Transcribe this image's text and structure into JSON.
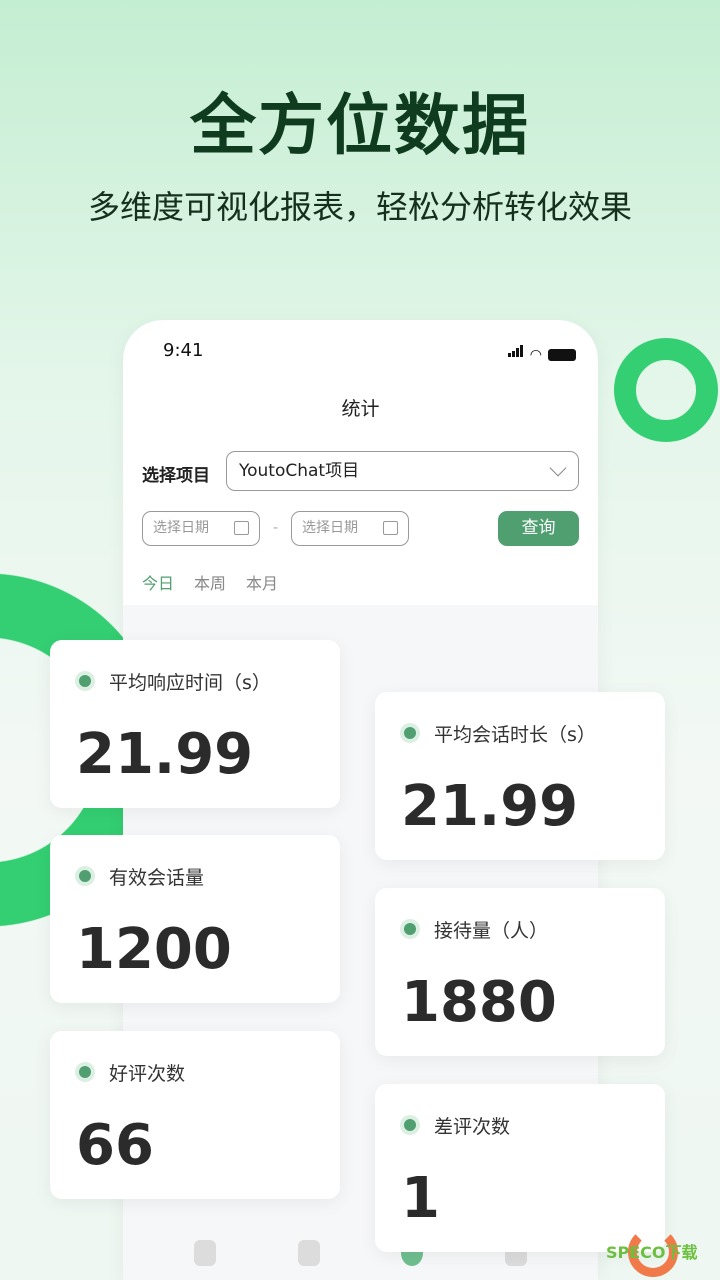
{
  "headline": "全方位数据",
  "subheadline": "多维度可视化报表，轻松分析转化效果",
  "phone": {
    "time": "9:41",
    "nav_title": "统计",
    "project_label": "选择项目",
    "project_value": "YoutoChat项目",
    "date_start_placeholder": "选择日期",
    "date_end_placeholder": "选择日期",
    "date_separator": "-",
    "query_button": "查询",
    "tabs": [
      {
        "label": "今日",
        "active": true
      },
      {
        "label": "本周"
      },
      {
        "label": "本月"
      }
    ],
    "tabbar": [
      "chat-icon",
      "clipboard-icon",
      "pie-chart-icon",
      "user-icon"
    ]
  },
  "cards": [
    {
      "label": "平均响应时间（s）",
      "value": "21.99"
    },
    {
      "label": "平均会话时长（s）",
      "value": "21.99"
    },
    {
      "label": "有效会话量",
      "value": "1200"
    },
    {
      "label": "接待量（人）",
      "value": "1880"
    },
    {
      "label": "好评次数",
      "value": "66"
    },
    {
      "label": "差评次数",
      "value": "1"
    }
  ],
  "watermark": "SPECO下载",
  "colors": {
    "accent": "#4f9f70",
    "ring": "#34cf72",
    "title": "#0f3b1f"
  }
}
